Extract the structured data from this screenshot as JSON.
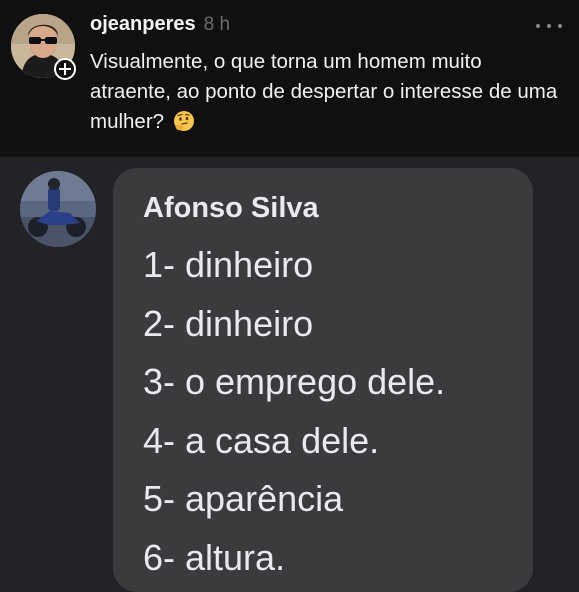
{
  "post": {
    "username": "ojeanperes",
    "timestamp": "8 h",
    "text": "Visualmente, o que torna um homem muito atraente, ao ponto de despertar o interesse de uma mulher?",
    "emoji": "thinking-face-emoji",
    "avatar_icon": "profile-photo-sunglasses",
    "follow_icon": "plus-icon",
    "more_icon": "more-options-icon"
  },
  "comment": {
    "author": "Afonso Silva",
    "avatar_icon": "profile-photo-motorcycle",
    "lines": [
      "1- dinheiro",
      "2- dinheiro",
      "3- o emprego dele.",
      "4- a casa dele.",
      "5- aparência",
      "6- altura."
    ]
  },
  "colors": {
    "post_background": "#101010",
    "page_background": "#222326",
    "bubble_background": "#3a3b3c",
    "text_primary": "#f1f1f1",
    "text_muted": "#6c6c6c"
  }
}
